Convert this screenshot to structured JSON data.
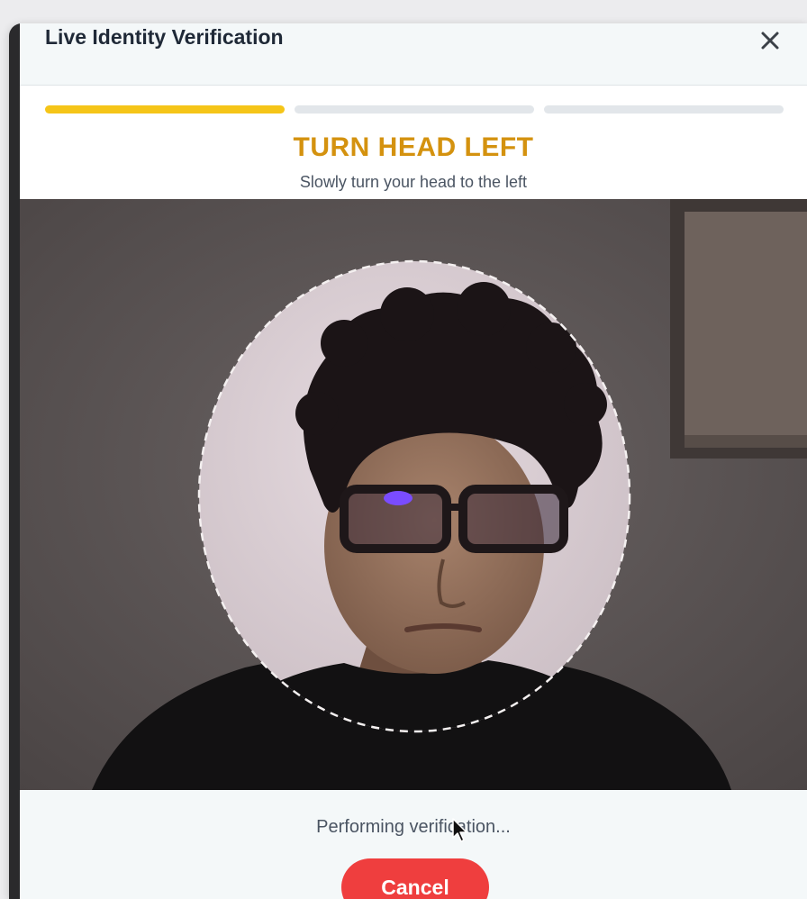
{
  "modal": {
    "title": "Live Identity Verification",
    "close_icon": "close-icon"
  },
  "progress": {
    "total_steps": 3,
    "current_step": 1,
    "active_color": "#f5c518",
    "inactive_color": "#e2e6ea"
  },
  "instruction": {
    "title": "TURN HEAD LEFT",
    "subtitle": "Slowly turn your head to the left",
    "title_color": "#d4920f"
  },
  "camera": {
    "face_guide": "dashed-oval-face-guide"
  },
  "footer": {
    "status": "Performing verification...",
    "cancel_label": "Cancel",
    "cancel_color": "#ef3e3e"
  },
  "pointer": "mouse-cursor-icon"
}
